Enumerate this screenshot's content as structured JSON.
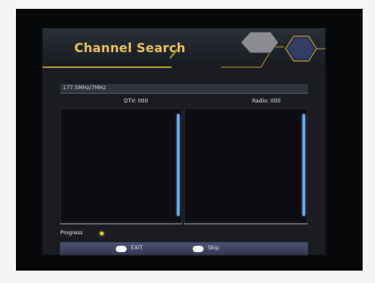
{
  "screen": {
    "title": "Channel Search",
    "frequency": "177.5MHz/7MHz",
    "dtv_label": "DTV: 000",
    "radio_label": "Radio: 000",
    "progress_label": "Progress",
    "footer": {
      "exit_label": "EXIT",
      "skip_label": "Skip"
    },
    "icons": {
      "title_decoration": "hexagon-decoration-icon",
      "progress_indicator": "progress-dot-icon",
      "exit_key": "remote-exit-key-icon",
      "skip_key": "remote-key-icon"
    },
    "colors": {
      "title": "#e8c15b",
      "accent_gold": "#a98d2e",
      "scrollbar": "#6ea9ea",
      "progress": "#f1d126",
      "footer": "#4b5173"
    }
  }
}
